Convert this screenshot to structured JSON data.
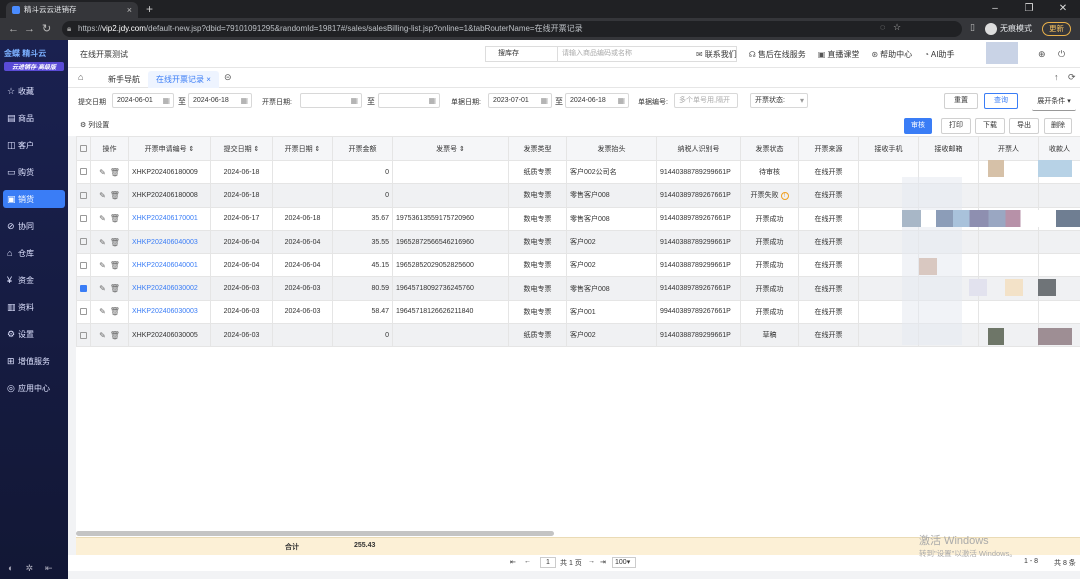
{
  "browser": {
    "tab_title": "精斗云云进销存",
    "url_host": "vip2.jdy.com",
    "url_rest": "/default-new.jsp?dbid=79101091295&randomId=19817#/sales/salesBilling-list.jsp?online=1&tabRouterName=在线开票记录",
    "url_scheme": "https://",
    "profile": "无痕模式",
    "update": "更新"
  },
  "sidebar": {
    "logo": "金蝶 精斗云",
    "logo_sub": "云进销存·高级版",
    "items": [
      {
        "icon": "☆",
        "label": "收藏"
      },
      {
        "icon": "▤",
        "label": "商品"
      },
      {
        "icon": "◫",
        "label": "客户"
      },
      {
        "icon": "▭",
        "label": "购货"
      },
      {
        "icon": "▣",
        "label": "销货"
      },
      {
        "icon": "⊘",
        "label": "协同"
      },
      {
        "icon": "⌂",
        "label": "仓库"
      },
      {
        "icon": "¥",
        "label": "资金"
      },
      {
        "icon": "▥",
        "label": "资料"
      },
      {
        "icon": "⚙",
        "label": "设置"
      },
      {
        "icon": "⊞",
        "label": "增值服务"
      },
      {
        "icon": "◎",
        "label": "应用中心"
      }
    ]
  },
  "topbar": {
    "title": "在线开票测试",
    "search_type": "搜库存",
    "search_placeholder": "请输入商品编码或名称",
    "links": [
      "联系我们",
      "售后在线服务",
      "直播课堂",
      "帮助中心",
      "AI助手"
    ]
  },
  "tabs": [
    "新手导航",
    "在线开票记录"
  ],
  "filters": {
    "submit_date_label": "提交日期",
    "submit_from": "2024-06-01",
    "submit_to": "2024-06-18",
    "invoice_date_label": "开票日期:",
    "invoice_from": "",
    "invoice_to": "",
    "doc_date_label": "单据日期:",
    "doc_from": "2023-07-01",
    "doc_to": "2024-06-18",
    "doc_no_label": "单据编号:",
    "doc_no_placeholder": "多个单号用,隔开",
    "status_label": "开票状态:",
    "to_sep": "至",
    "reset": "重置",
    "query": "查询",
    "expand": "展开条件"
  },
  "toolbar": {
    "col_settings": "列设置",
    "buttons": [
      "审核",
      "打印",
      "下载",
      "导出",
      "删除"
    ]
  },
  "table": {
    "headers": [
      "操作",
      "开票申请编号",
      "提交日期",
      "开票日期",
      "开票金额",
      "发票号",
      "发票类型",
      "发票抬头",
      "纳税人识别号",
      "发票状态",
      "开票来源",
      "接收手机",
      "接收邮箱",
      "开票人",
      "收款人"
    ],
    "rows": [
      {
        "no": "XHKP202406180009",
        "submit": "2024-06-18",
        "invdate": "",
        "amount": "0",
        "invno": "",
        "type": "纸质专票",
        "head": "客户002公司名",
        "taxid": "9144038878929​9661P",
        "status": "待审核",
        "source": "在线开票",
        "link": false,
        "checked": false
      },
      {
        "no": "XHKP202406180008",
        "submit": "2024-06-18",
        "invdate": "",
        "amount": "0",
        "invno": "",
        "type": "数电专票",
        "head": "零售客户008",
        "taxid": "91440389789267661P",
        "status": "开票失败",
        "source": "在线开票",
        "link": false,
        "checked": false
      },
      {
        "no": "XHKP202406170001",
        "submit": "2024-06-17",
        "invdate": "2024-06-18",
        "amount": "35.67",
        "invno": "19753613559175720960",
        "type": "数电专票",
        "head": "零售客户008",
        "taxid": "91440389789267661P",
        "status": "开票成功",
        "source": "在线开票",
        "link": true,
        "checked": false
      },
      {
        "no": "XHKP202406040003",
        "submit": "2024-06-04",
        "invdate": "2024-06-04",
        "amount": "35.55",
        "invno": "19652872566546216960",
        "type": "数电专票",
        "head": "客户002",
        "taxid": "91440388789299661P",
        "status": "开票成功",
        "source": "在线开票",
        "link": true,
        "checked": false
      },
      {
        "no": "XHKP202406040001",
        "submit": "2024-06-04",
        "invdate": "2024-06-04",
        "amount": "45.15",
        "invno": "19652852029052825600",
        "type": "数电专票",
        "head": "客户002",
        "taxid": "91440388789299661P",
        "status": "开票成功",
        "source": "在线开票",
        "link": true,
        "checked": false
      },
      {
        "no": "XHKP202406030002",
        "submit": "2024-06-03",
        "invdate": "2024-06-03",
        "amount": "80.59",
        "invno": "19645718092736245760",
        "type": "数电专票",
        "head": "零售客户008",
        "taxid": "91440389789267661P",
        "status": "开票成功",
        "source": "在线开票",
        "link": true,
        "checked": true
      },
      {
        "no": "XHKP202406030003",
        "submit": "2024-06-03",
        "invdate": "2024-06-03",
        "amount": "58.47",
        "invno": "19645718126626211840",
        "type": "数电专票",
        "head": "客户001",
        "taxid": "99440389789267661P",
        "status": "开票成功",
        "source": "在线开票",
        "link": true,
        "checked": false
      },
      {
        "no": "XHKP202406030005",
        "submit": "2024-06-03",
        "invdate": "",
        "amount": "0",
        "invno": "",
        "type": "纸质专票",
        "head": "客户002",
        "taxid": "91440388789299661P",
        "status": "草稿",
        "source": "在线开票",
        "link": false,
        "checked": false
      }
    ]
  },
  "summary": {
    "label": "合计",
    "amount": "255.43"
  },
  "pager": {
    "page": "1",
    "total_pages": "共 1 页",
    "page_size": "100",
    "range": "1 - 8",
    "total": "共 8 条"
  },
  "watermark": {
    "line1": "激活 Windows",
    "line2": "转到\"设置\"以激活 Windows。"
  },
  "colors": {
    "accent": "#3a7df6",
    "sidebar": "#1a2150",
    "summary_bg": "#fcf0d6"
  }
}
